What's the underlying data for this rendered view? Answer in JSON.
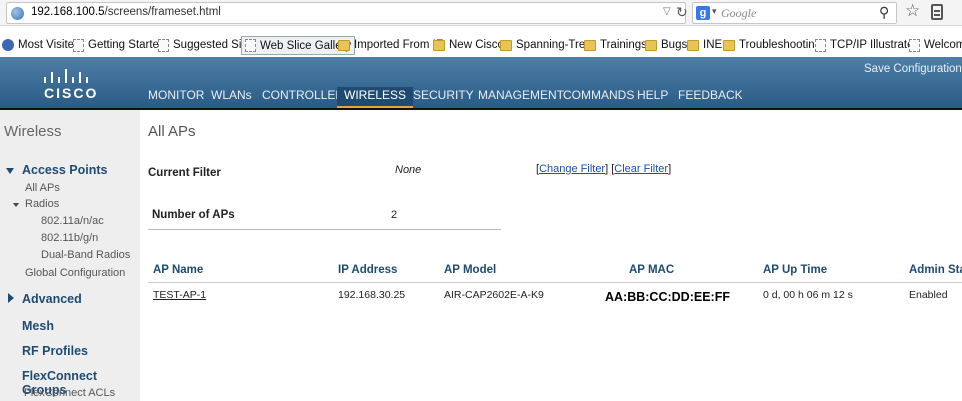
{
  "browser": {
    "url_host": "192.168.100.5",
    "url_path": "/screens/frameset.html",
    "search_engine_letter": "g",
    "search_placeholder": "Google"
  },
  "bookmarks": [
    {
      "label": "Most Visited",
      "icon": "blue"
    },
    {
      "label": "Getting Started",
      "icon": "page"
    },
    {
      "label": "Suggested Sites",
      "icon": "page"
    },
    {
      "label": "Web Slice Gallery",
      "icon": "page",
      "active": true
    },
    {
      "label": "Imported From IE",
      "icon": "folder"
    },
    {
      "label": "New Cisco",
      "icon": "folder"
    },
    {
      "label": "Spanning-Tree",
      "icon": "folder"
    },
    {
      "label": "Trainings",
      "icon": "folder"
    },
    {
      "label": "Bugs",
      "icon": "folder"
    },
    {
      "label": "INE",
      "icon": "folder"
    },
    {
      "label": "Troubleshooting",
      "icon": "folder"
    },
    {
      "label": "TCP/IP Illustrated",
      "icon": "page"
    },
    {
      "label": "Welcom",
      "icon": "page"
    }
  ],
  "header": {
    "brand": "CISCO",
    "save_config": "Save Configuration",
    "nav": [
      "MONITOR",
      "WLANs",
      "CONTROLLER",
      "WIRELESS",
      "SECURITY",
      "MANAGEMENT",
      "COMMANDS",
      "HELP",
      "FEEDBACK"
    ],
    "active_nav": "WIRELESS",
    "accent_color": "#f0a430"
  },
  "sidebar": {
    "title": "Wireless",
    "access_points": "Access Points",
    "all_aps": "All APs",
    "radios": "Radios",
    "radio_a": "802.11a/n/ac",
    "radio_b": "802.11b/g/n",
    "dual_band": "Dual-Band Radios",
    "global_config": "Global Configuration",
    "advanced": "Advanced",
    "mesh": "Mesh",
    "rf_profiles": "RF Profiles",
    "flexconnect_groups": "FlexConnect Groups",
    "flexconnect_acls": "FlexConnect ACLs"
  },
  "main": {
    "title": "All APs",
    "current_filter_label": "Current Filter",
    "current_filter_value": "None",
    "change_filter": "Change Filter",
    "clear_filter": "Clear Filter",
    "num_aps_label": "Number of APs",
    "num_aps_value": "2",
    "columns": [
      "AP Name",
      "IP Address",
      "AP Model",
      "AP MAC",
      "AP Up Time",
      "Admin Sta"
    ],
    "rows": [
      {
        "ap_name": "TEST-AP-1",
        "ip": "192.168.30.25",
        "model": "AIR-CAP2602E-A-K9",
        "mac": "AA:BB:CC:DD:EE:FF",
        "uptime": "0 d, 00 h 06 m 12 s",
        "admin": "Enabled"
      }
    ]
  }
}
